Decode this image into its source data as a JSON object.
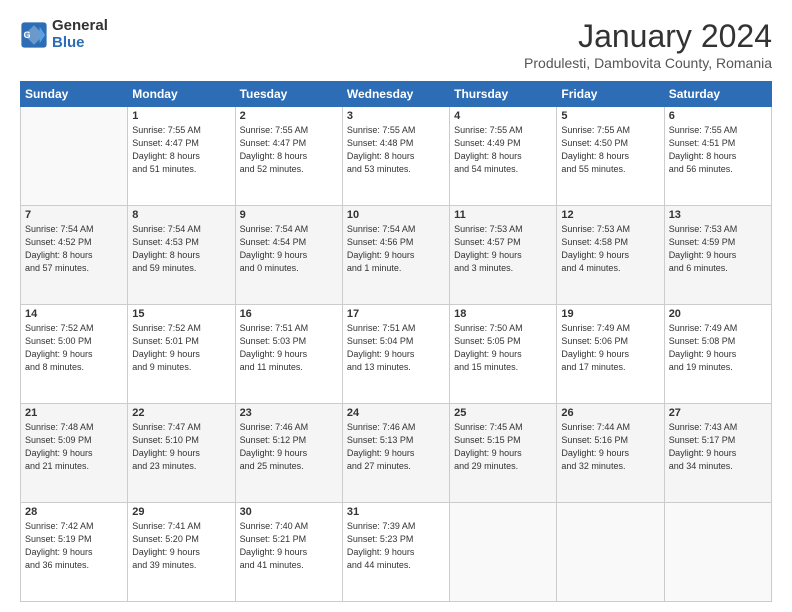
{
  "logo": {
    "general": "General",
    "blue": "Blue"
  },
  "title": "January 2024",
  "subtitle": "Produlesti, Dambovita County, Romania",
  "weekdays": [
    "Sunday",
    "Monday",
    "Tuesday",
    "Wednesday",
    "Thursday",
    "Friday",
    "Saturday"
  ],
  "weeks": [
    [
      {
        "day": "",
        "info": ""
      },
      {
        "day": "1",
        "info": "Sunrise: 7:55 AM\nSunset: 4:47 PM\nDaylight: 8 hours\nand 51 minutes."
      },
      {
        "day": "2",
        "info": "Sunrise: 7:55 AM\nSunset: 4:47 PM\nDaylight: 8 hours\nand 52 minutes."
      },
      {
        "day": "3",
        "info": "Sunrise: 7:55 AM\nSunset: 4:48 PM\nDaylight: 8 hours\nand 53 minutes."
      },
      {
        "day": "4",
        "info": "Sunrise: 7:55 AM\nSunset: 4:49 PM\nDaylight: 8 hours\nand 54 minutes."
      },
      {
        "day": "5",
        "info": "Sunrise: 7:55 AM\nSunset: 4:50 PM\nDaylight: 8 hours\nand 55 minutes."
      },
      {
        "day": "6",
        "info": "Sunrise: 7:55 AM\nSunset: 4:51 PM\nDaylight: 8 hours\nand 56 minutes."
      }
    ],
    [
      {
        "day": "7",
        "info": "Sunrise: 7:54 AM\nSunset: 4:52 PM\nDaylight: 8 hours\nand 57 minutes."
      },
      {
        "day": "8",
        "info": "Sunrise: 7:54 AM\nSunset: 4:53 PM\nDaylight: 8 hours\nand 59 minutes."
      },
      {
        "day": "9",
        "info": "Sunrise: 7:54 AM\nSunset: 4:54 PM\nDaylight: 9 hours\nand 0 minutes."
      },
      {
        "day": "10",
        "info": "Sunrise: 7:54 AM\nSunset: 4:56 PM\nDaylight: 9 hours\nand 1 minute."
      },
      {
        "day": "11",
        "info": "Sunrise: 7:53 AM\nSunset: 4:57 PM\nDaylight: 9 hours\nand 3 minutes."
      },
      {
        "day": "12",
        "info": "Sunrise: 7:53 AM\nSunset: 4:58 PM\nDaylight: 9 hours\nand 4 minutes."
      },
      {
        "day": "13",
        "info": "Sunrise: 7:53 AM\nSunset: 4:59 PM\nDaylight: 9 hours\nand 6 minutes."
      }
    ],
    [
      {
        "day": "14",
        "info": "Sunrise: 7:52 AM\nSunset: 5:00 PM\nDaylight: 9 hours\nand 8 minutes."
      },
      {
        "day": "15",
        "info": "Sunrise: 7:52 AM\nSunset: 5:01 PM\nDaylight: 9 hours\nand 9 minutes."
      },
      {
        "day": "16",
        "info": "Sunrise: 7:51 AM\nSunset: 5:03 PM\nDaylight: 9 hours\nand 11 minutes."
      },
      {
        "day": "17",
        "info": "Sunrise: 7:51 AM\nSunset: 5:04 PM\nDaylight: 9 hours\nand 13 minutes."
      },
      {
        "day": "18",
        "info": "Sunrise: 7:50 AM\nSunset: 5:05 PM\nDaylight: 9 hours\nand 15 minutes."
      },
      {
        "day": "19",
        "info": "Sunrise: 7:49 AM\nSunset: 5:06 PM\nDaylight: 9 hours\nand 17 minutes."
      },
      {
        "day": "20",
        "info": "Sunrise: 7:49 AM\nSunset: 5:08 PM\nDaylight: 9 hours\nand 19 minutes."
      }
    ],
    [
      {
        "day": "21",
        "info": "Sunrise: 7:48 AM\nSunset: 5:09 PM\nDaylight: 9 hours\nand 21 minutes."
      },
      {
        "day": "22",
        "info": "Sunrise: 7:47 AM\nSunset: 5:10 PM\nDaylight: 9 hours\nand 23 minutes."
      },
      {
        "day": "23",
        "info": "Sunrise: 7:46 AM\nSunset: 5:12 PM\nDaylight: 9 hours\nand 25 minutes."
      },
      {
        "day": "24",
        "info": "Sunrise: 7:46 AM\nSunset: 5:13 PM\nDaylight: 9 hours\nand 27 minutes."
      },
      {
        "day": "25",
        "info": "Sunrise: 7:45 AM\nSunset: 5:15 PM\nDaylight: 9 hours\nand 29 minutes."
      },
      {
        "day": "26",
        "info": "Sunrise: 7:44 AM\nSunset: 5:16 PM\nDaylight: 9 hours\nand 32 minutes."
      },
      {
        "day": "27",
        "info": "Sunrise: 7:43 AM\nSunset: 5:17 PM\nDaylight: 9 hours\nand 34 minutes."
      }
    ],
    [
      {
        "day": "28",
        "info": "Sunrise: 7:42 AM\nSunset: 5:19 PM\nDaylight: 9 hours\nand 36 minutes."
      },
      {
        "day": "29",
        "info": "Sunrise: 7:41 AM\nSunset: 5:20 PM\nDaylight: 9 hours\nand 39 minutes."
      },
      {
        "day": "30",
        "info": "Sunrise: 7:40 AM\nSunset: 5:21 PM\nDaylight: 9 hours\nand 41 minutes."
      },
      {
        "day": "31",
        "info": "Sunrise: 7:39 AM\nSunset: 5:23 PM\nDaylight: 9 hours\nand 44 minutes."
      },
      {
        "day": "",
        "info": ""
      },
      {
        "day": "",
        "info": ""
      },
      {
        "day": "",
        "info": ""
      }
    ]
  ]
}
